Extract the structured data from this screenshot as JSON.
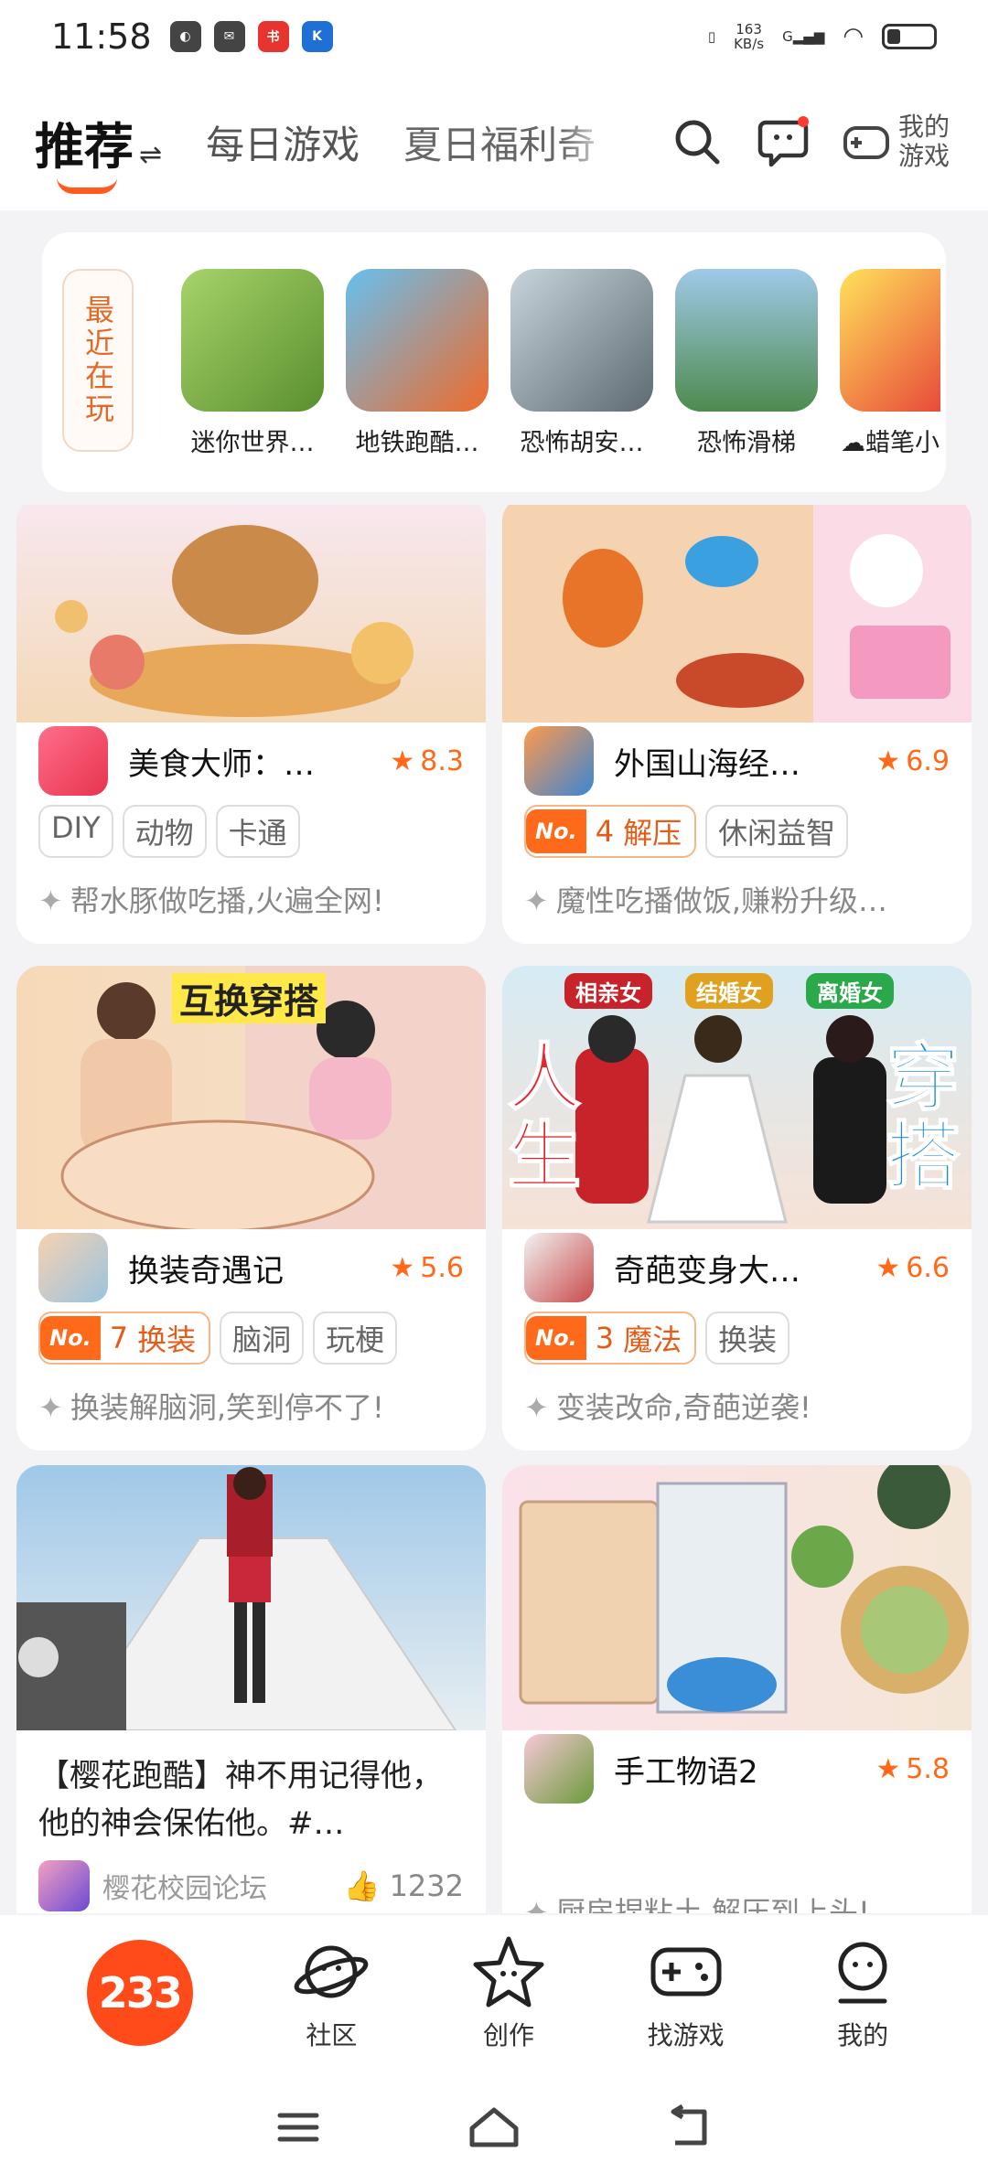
{
  "status_bar": {
    "time": "11:58",
    "net_speed": "163",
    "net_unit": "KB/s",
    "signal_label": "G"
  },
  "top_nav": {
    "tabs": [
      {
        "label": "推荐",
        "swap": "⇌"
      },
      {
        "label": "每日游戏"
      },
      {
        "label": "夏日福利奇"
      }
    ],
    "my_games_label": "我的游戏"
  },
  "recent": {
    "label": "最近在玩",
    "games": [
      {
        "name": "迷你世界…",
        "color": "#8bbf4b"
      },
      {
        "name": "地铁跑酷…",
        "color": "#4aa9e6"
      },
      {
        "name": "恐怖胡安…",
        "color": "#8a9aa6"
      },
      {
        "name": "恐怖滑梯",
        "color": "#6aa86e"
      },
      {
        "name": "蜡笔小",
        "color": "#f6d84a"
      }
    ]
  },
  "cards": [
    {
      "title": "美食大师：…",
      "rating": "8.3",
      "tags": [
        "DIY",
        "动物",
        "卡通"
      ],
      "desc": "帮水豚做吃播,火遍全网!"
    },
    {
      "title": "外国山海经…",
      "rating": "6.9",
      "rank": {
        "no": "No.",
        "num": "4",
        "label": "解压"
      },
      "tags": [
        "休闲益智"
      ],
      "desc": "魔性吃播做饭,赚粉升级…"
    },
    {
      "title": "换装奇遇记",
      "rating": "5.6",
      "banner_text": "互换穿搭",
      "rank": {
        "no": "No.",
        "num": "7",
        "label": "换装"
      },
      "tags": [
        "脑洞",
        "玩梗"
      ],
      "desc": "换装解脑洞,笑到停不了!"
    },
    {
      "title": "奇葩变身大…",
      "rating": "6.6",
      "pills": [
        "相亲女",
        "结婚女",
        "离婚女"
      ],
      "big_left": "人生",
      "big_right": "穿搭",
      "rank": {
        "no": "No.",
        "num": "3",
        "label": "魔法"
      },
      "tags": [
        "换装"
      ],
      "desc": "变装改命,奇葩逆袭!"
    },
    {
      "post_text": "【樱花跑酷】神不用记得他，他的神会保佑他。#…",
      "author": "樱花校园论坛",
      "likes": "1232"
    },
    {
      "title": "手工物语2",
      "rating": "5.8",
      "desc": "厨房捏粘土 解压到上头!"
    }
  ],
  "bottom_bar": {
    "logo": "233",
    "items": [
      {
        "label": "社区"
      },
      {
        "label": "创作"
      },
      {
        "label": "找游戏"
      },
      {
        "label": "我的"
      }
    ]
  }
}
